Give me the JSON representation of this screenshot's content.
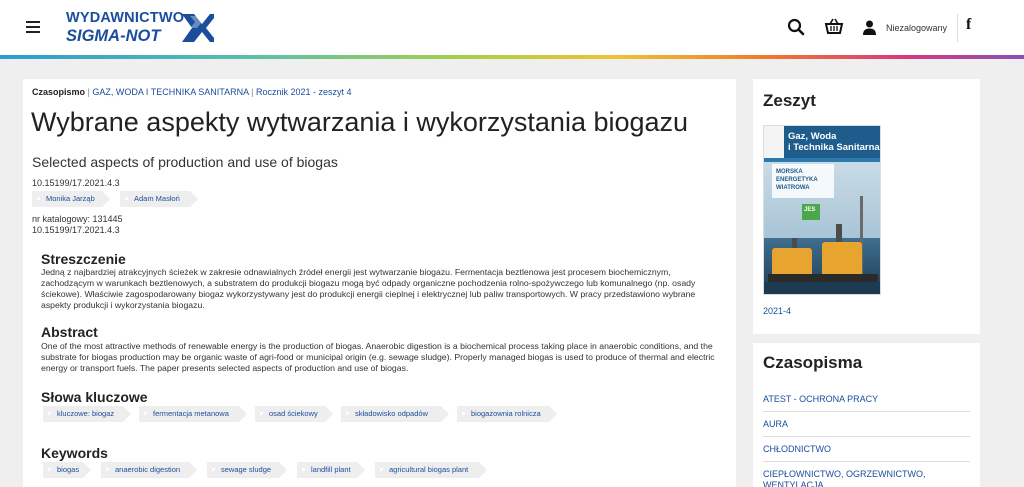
{
  "header": {
    "logo_line1": "WYDAWNICTWO",
    "logo_line2": "SIGMA-NOT",
    "user_label": "Niezalogowany",
    "facebook": "f",
    "icons": [
      "menu-icon",
      "search-icon",
      "cart-icon",
      "user-icon",
      "facebook-icon"
    ]
  },
  "breadcrumb": {
    "type": "Czasopismo",
    "journal": "GAZ, WODA I TECHNIKA SANITARNA",
    "volume": "Rocznik 2021 - zeszyt 4",
    "separator": "|"
  },
  "article": {
    "title": "Wybrane aspekty wytwarzania i wykorzystania biogazu",
    "subtitle": "Selected aspects of production and use of biogas",
    "doi": "10.15199/17.2021.4.3",
    "authors": [
      "Monika Jarząb",
      "Adam Masłoń"
    ],
    "catalog": "nr katalogowy: 131445",
    "doi2": "10.15199/17.2021.4.3"
  },
  "sections": {
    "streszczenie_h": "Streszczenie",
    "streszczenie": "Jedną z najbardziej atrakcyjnych ścieżek w zakresie odnawialnych źródeł energii jest wytwarzanie biogazu. Fermentacja beztlenowa jest procesem biochemicznym, zachodzącym w warunkach beztlenowych, a substratem do produkcji biogazu mogą być odpady organiczne pochodzenia rolno-spożywczego lub komunalnego (np. osady ściekowe). Właściwie zagospodarowany biogaz wykorzystywany jest do produkcji energii cieplnej i elektrycznej lub paliw transportowych. W pracy przedstawiono wybrane aspekty produkcji i wykorzystania biogazu.",
    "abstract_h": "Abstract",
    "abstract": "One of the most attractive methods of renewable energy is the production of biogas. Anaerobic digestion is a biochemical process taking place in anaerobic conditions, and the substrate for biogas production may be organic waste of agri-food or municipal origin (e.g. sewage sludge). Properly managed biogas is used to produce of thermal and electric energy or transport fuels. The paper presents selected aspects of production and use of biogas.",
    "slowa_h": "Słowa kluczowe",
    "slowa": [
      "kluczowe: biogaz",
      "fermentacja metanowa",
      "osad ściekowy",
      "składowisko odpadów",
      "biogazownia rolnicza"
    ],
    "keywords_h": "Keywords",
    "keywords": [
      "biogas",
      "anaerobic digestion",
      "sewage sludge",
      "landfill plant",
      "agricultural biogas plant"
    ]
  },
  "sidebar": {
    "zeszyt_h": "Zeszyt",
    "issue_label": "2021-4",
    "cover": {
      "title1": "Gaz, Woda",
      "title2": "i Technika Sanitarna",
      "topic1": "MORSKA",
      "topic2": "ENERGETYKA",
      "topic3": "WIATROWA",
      "badge": "JES"
    },
    "czasopisma_h": "Czasopisma",
    "magazines": [
      "ATEST - OCHRONA PRACY",
      "AURA",
      "CHŁODNICTWO",
      "CIEPŁOWNICTWO, OGRZEWNICTWO, WENTYLACJA"
    ]
  },
  "colors": {
    "link": "#1a4d9c",
    "text": "#222222",
    "tag_bg": "#eeeeee",
    "page_bg": "#efefef"
  }
}
